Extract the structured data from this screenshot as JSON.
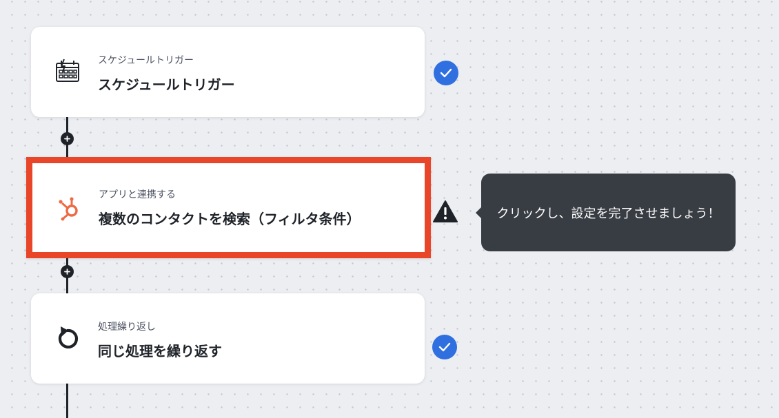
{
  "steps": [
    {
      "kind": "スケジュールトリガー",
      "title": "スケジュールトリガー",
      "icon": "schedule-calendar-icon",
      "status": "complete"
    },
    {
      "kind": "アプリと連携する",
      "title": "複数のコンタクトを検索（フィルタ条件）",
      "icon": "hubspot-icon",
      "status": "incomplete",
      "highlighted": true
    },
    {
      "kind": "処理繰り返し",
      "title": "同じ処理を繰り返す",
      "icon": "repeat-arrow-icon",
      "status": "complete"
    }
  ],
  "tooltip": {
    "text": "クリックし、設定を完了させましょう！"
  },
  "colors": {
    "highlight_border": "#e94629",
    "check_badge": "#2f6fe0",
    "hubspot_orange": "#ee6a45",
    "tooltip_bg": "#383c43",
    "flow_line": "#1f2329"
  }
}
